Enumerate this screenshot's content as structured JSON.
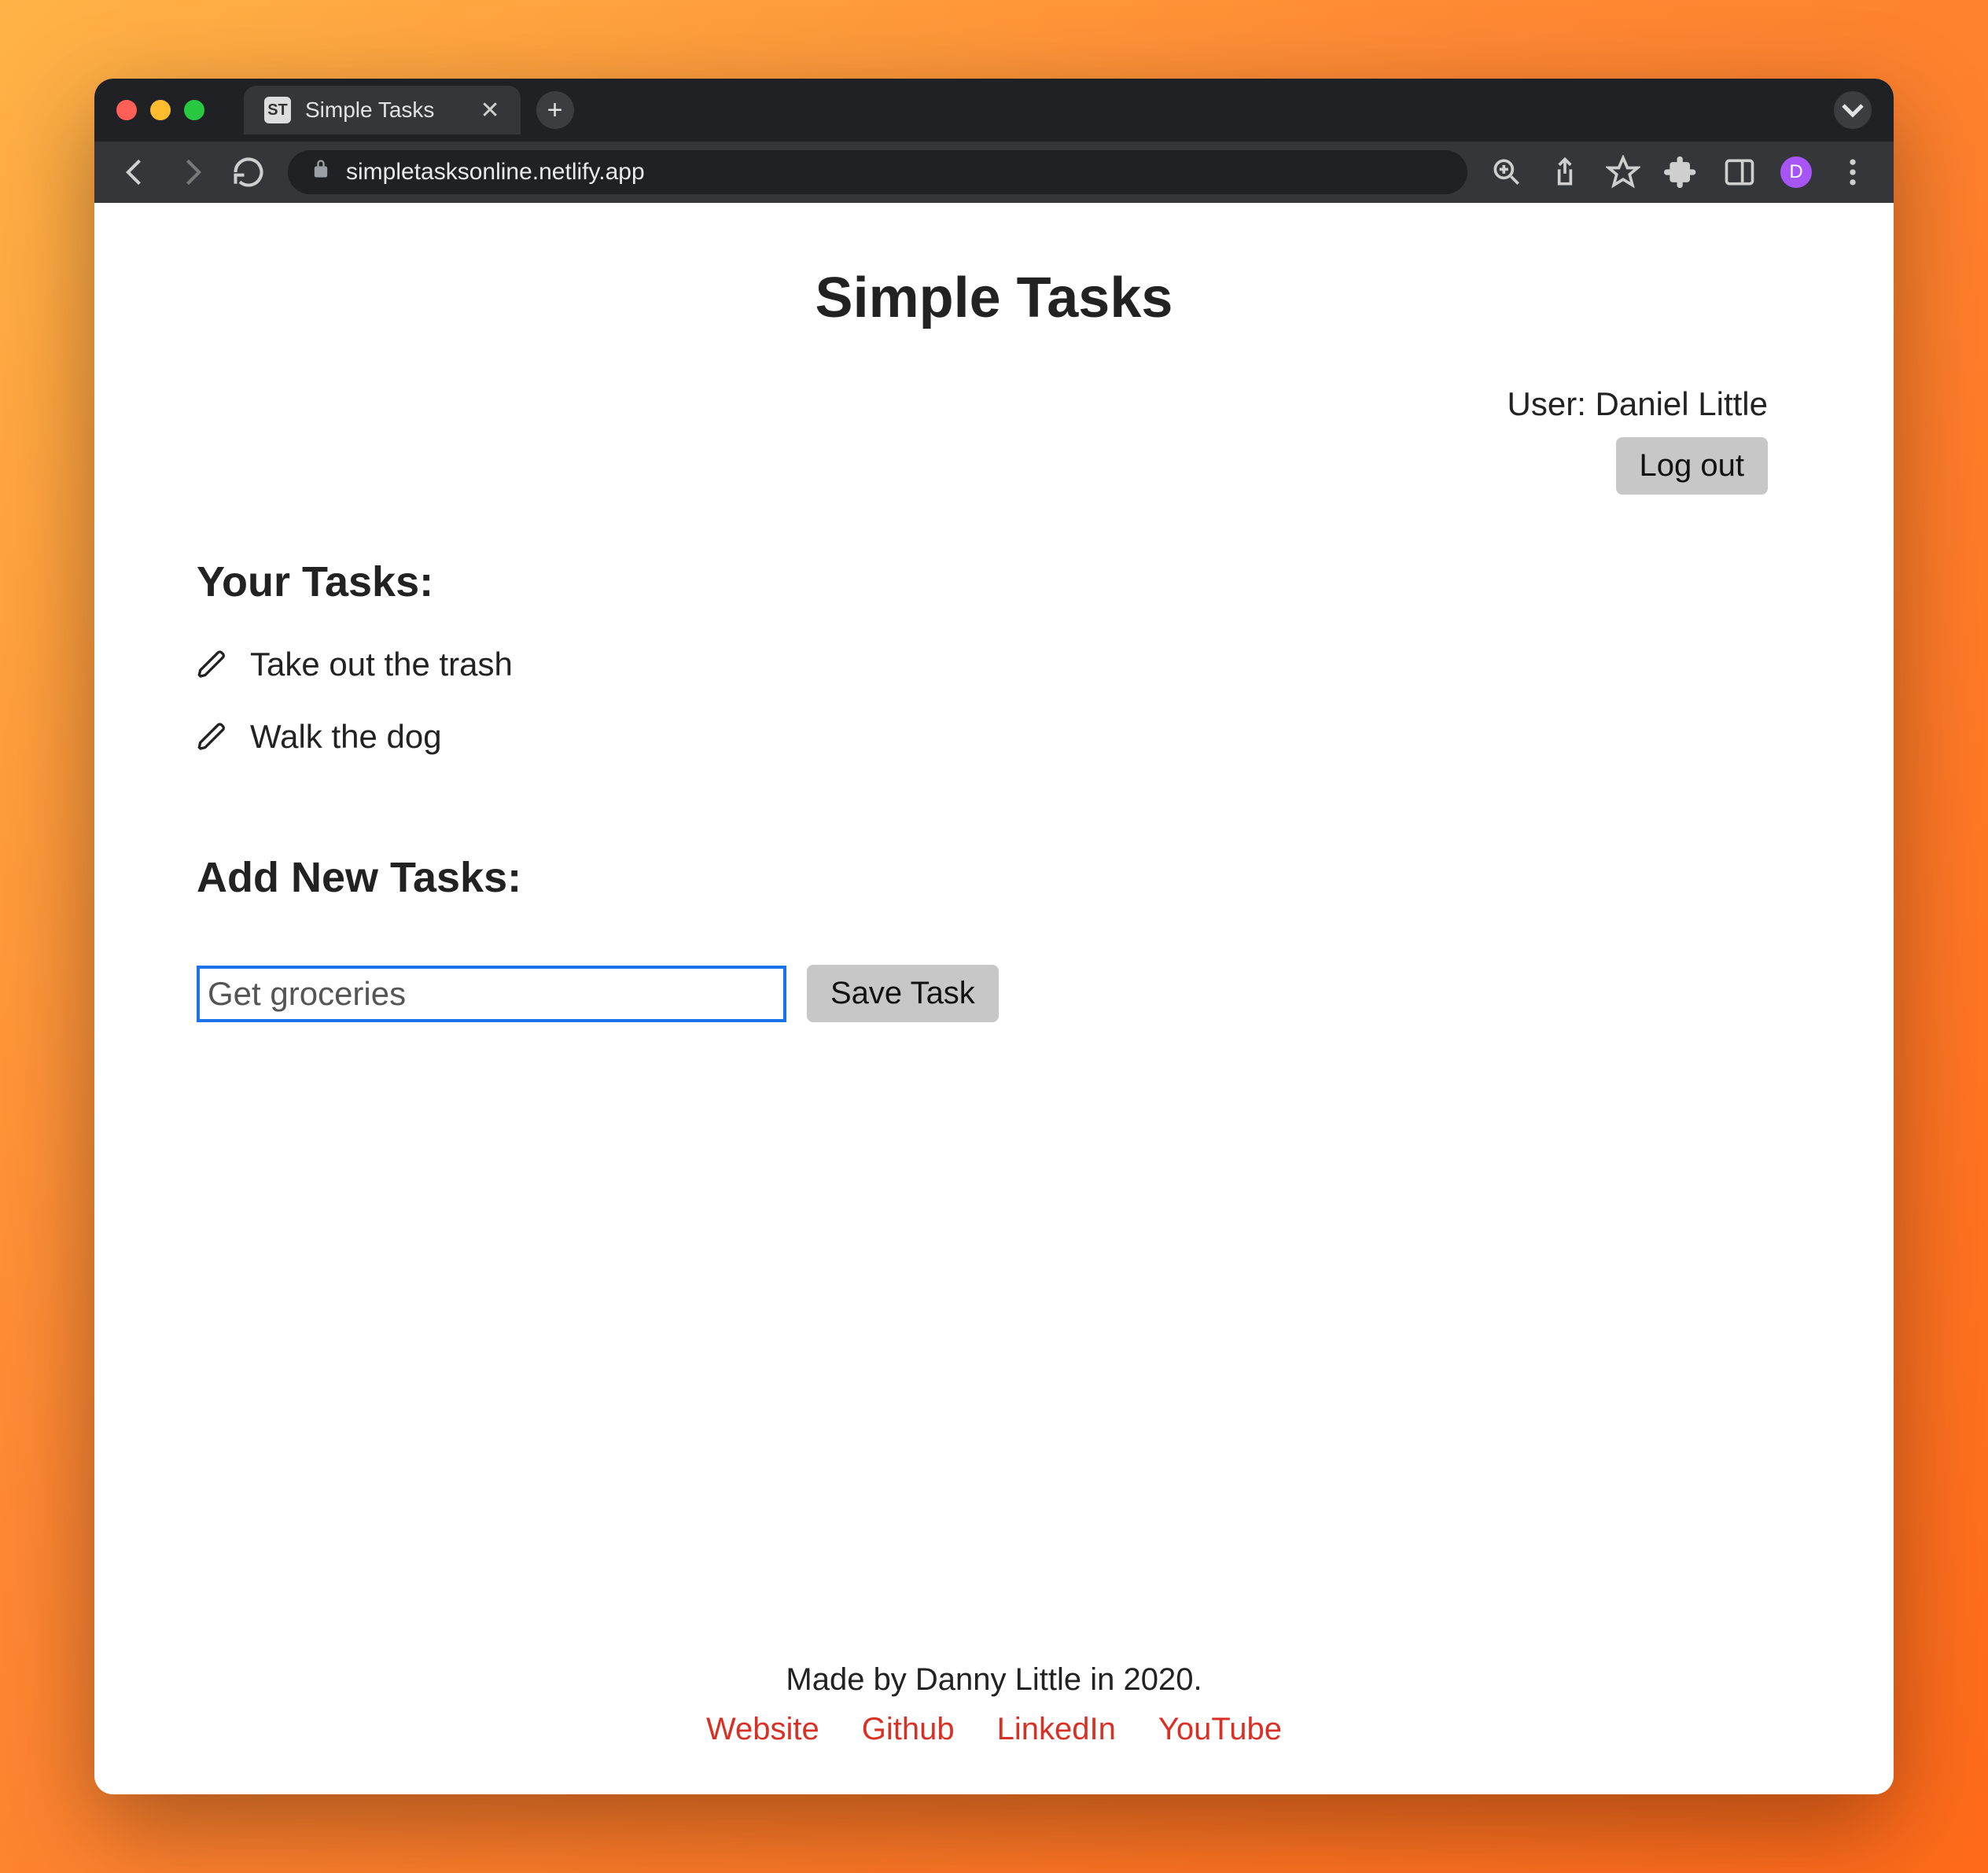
{
  "browser": {
    "tab": {
      "favicon_text": "ST",
      "title": "Simple Tasks"
    },
    "url": "simpletasksonline.netlify.app",
    "avatar_initial": "D"
  },
  "app": {
    "title": "Simple Tasks",
    "user": {
      "label_prefix": "User: ",
      "name": "Daniel Little"
    },
    "logout_label": "Log out",
    "your_tasks_heading": "Your Tasks:",
    "tasks": [
      {
        "text": "Take out the trash"
      },
      {
        "text": "Walk the dog"
      }
    ],
    "add_tasks_heading": "Add New Tasks:",
    "new_task_input_value": "Get groceries",
    "save_task_label": "Save Task"
  },
  "footer": {
    "credit": "Made by Danny Little in 2020.",
    "links": [
      {
        "label": "Website"
      },
      {
        "label": "Github"
      },
      {
        "label": "LinkedIn"
      },
      {
        "label": "YouTube"
      }
    ]
  }
}
